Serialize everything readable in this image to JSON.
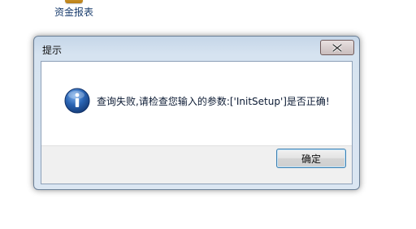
{
  "desktop": {
    "shortcut_label": "资金报表"
  },
  "dialog": {
    "title": "提示",
    "message": "查询失败,请检查您输入的参数:['InitSetup']是否正确!",
    "ok_label": "确定"
  },
  "icons": {
    "info": "info-icon",
    "close": "close-icon",
    "shortcut": "folder-icon"
  },
  "colors": {
    "dialog_frame": "#d6e3f0",
    "info_icon": "#2a64b3",
    "ok_border": "#3c7fb1"
  }
}
